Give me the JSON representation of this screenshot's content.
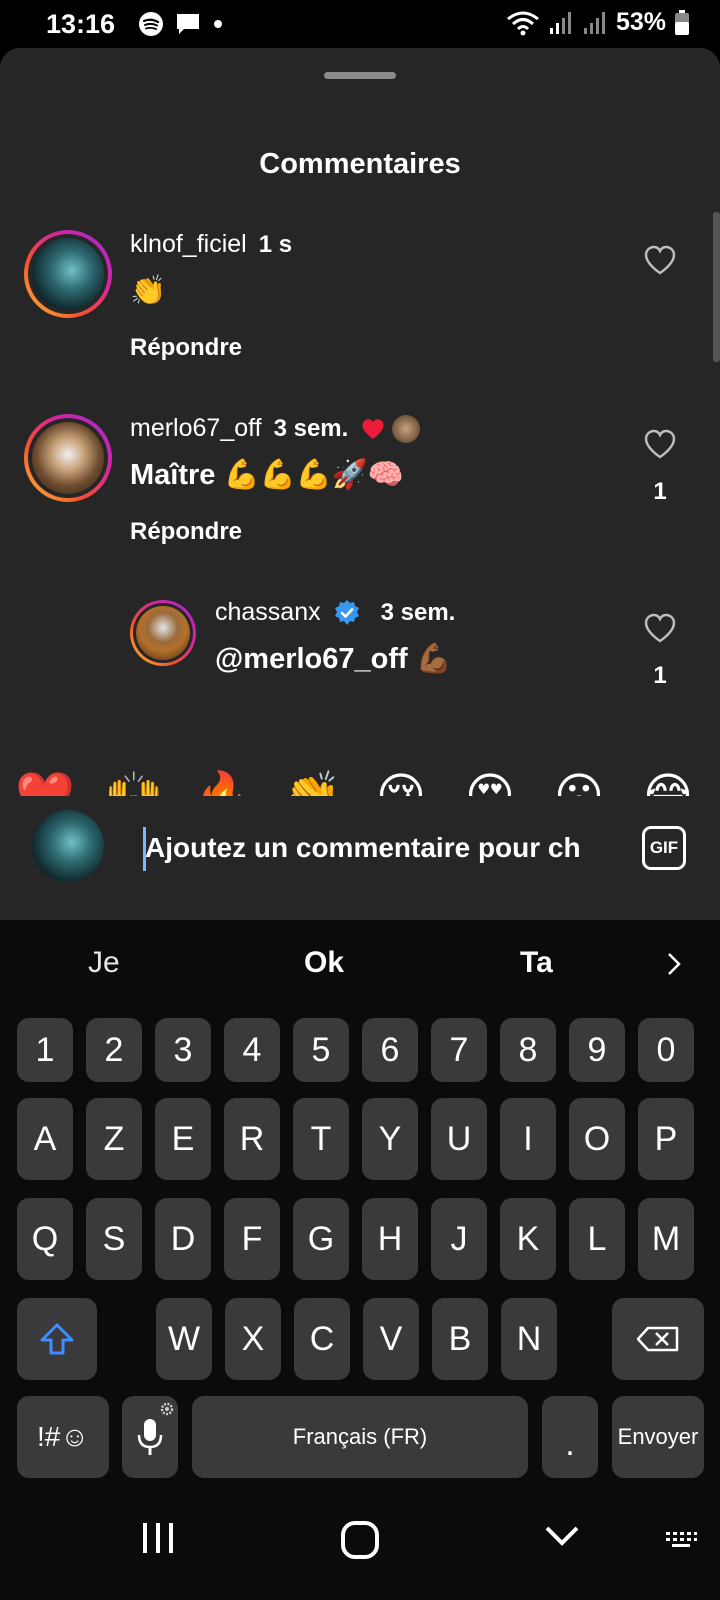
{
  "status_bar": {
    "time": "13:16",
    "battery": "53%",
    "left_icons": [
      "spotify-icon",
      "message-icon",
      "dot-icon"
    ],
    "right_icons": [
      "wifi-icon",
      "signal-icon",
      "signal-icon",
      "battery-icon"
    ]
  },
  "sheet": {
    "title": "Commentaires"
  },
  "comments": [
    {
      "username": "klnof_ficiel",
      "time": "1 s",
      "text": "👏",
      "reply_label": "Répondre",
      "likes": ""
    },
    {
      "username": "merlo67_off",
      "time": "3 sem.",
      "text": "Maître 💪💪💪🚀🧠",
      "reply_label": "Répondre",
      "likes": "1"
    },
    {
      "username": "chassanx",
      "time": "3 sem.",
      "text": "@merlo67_off 💪🏾",
      "likes": "1",
      "verified": true
    }
  ],
  "emoji_bar": [
    "❤️",
    "🙌",
    "🔥",
    "👏",
    "😢",
    "😍",
    "😮",
    "😂"
  ],
  "input": {
    "placeholder": "Ajoutez un commentaire pour ch",
    "gif_label": "GIF"
  },
  "keyboard": {
    "suggestions": [
      "Je",
      "Ok",
      "Ta"
    ],
    "row_numbers": [
      "1",
      "2",
      "3",
      "4",
      "5",
      "6",
      "7",
      "8",
      "9",
      "0"
    ],
    "row1": [
      "A",
      "Z",
      "E",
      "R",
      "T",
      "Y",
      "U",
      "I",
      "O",
      "P"
    ],
    "row2": [
      "Q",
      "S",
      "D",
      "F",
      "G",
      "H",
      "J",
      "K",
      "L",
      "M"
    ],
    "row3": [
      "W",
      "X",
      "C",
      "V",
      "B",
      "N"
    ],
    "symbols_label": "!#☺",
    "space_label": "Français (FR)",
    "period_label": ".",
    "send_label": "Envoyer"
  },
  "colors": {
    "sheet_bg": "#262626",
    "key_bg": "#3a3a3c",
    "heart_red": "#ed1c3a",
    "verified_blue": "#3897f0"
  }
}
